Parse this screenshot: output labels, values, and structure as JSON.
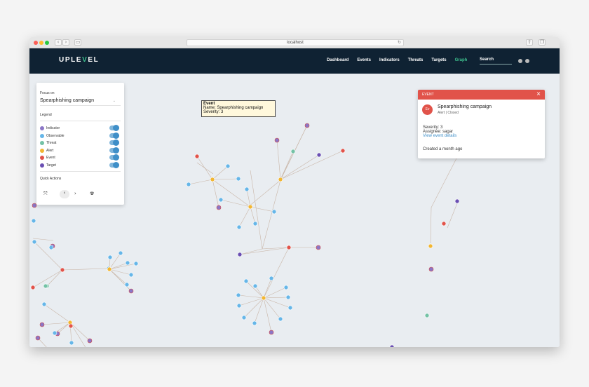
{
  "browser": {
    "url": "localhost"
  },
  "header": {
    "logo_a": "UPLE",
    "logo_b": "V",
    "logo_c": "EL",
    "nav": [
      "Dashboard",
      "Events",
      "Indicators",
      "Threats",
      "Targets",
      "Graph"
    ],
    "active_nav": "Graph",
    "search_label": "Search"
  },
  "panel": {
    "focus_label": "Focus on",
    "focus_value": "Spearphishing campaign",
    "legend_title": "Legend",
    "legend": [
      {
        "label": "Indicator",
        "color": "#8b76c6"
      },
      {
        "label": "Observable",
        "color": "#66b6e8"
      },
      {
        "label": "Threat",
        "color": "#74c2a6"
      },
      {
        "label": "Alert",
        "color": "#f2b632"
      },
      {
        "label": "Event",
        "color": "#e1534a"
      },
      {
        "label": "Target",
        "color": "#6a4fb3"
      }
    ],
    "quick_actions_title": "Quick Actions"
  },
  "tooltip": {
    "title": "Event",
    "name": "Name: Spearphishing campaign",
    "severity": "Severity: 3"
  },
  "card": {
    "header": "EVENT",
    "badge": "Ev",
    "title": "Spearphishing campaign",
    "subtitle": "Alert | Closed",
    "severity": "Severity: 3",
    "assignee": "Assignee: sagar",
    "link": "View event details",
    "created": "Created a month ago"
  },
  "colors": {
    "observable": "#66b6e8",
    "alert": "#f2b632",
    "event": "#e1534a",
    "target": "#6a4fb3",
    "indicator": "#8b76c6",
    "threat": "#74c2a6"
  }
}
